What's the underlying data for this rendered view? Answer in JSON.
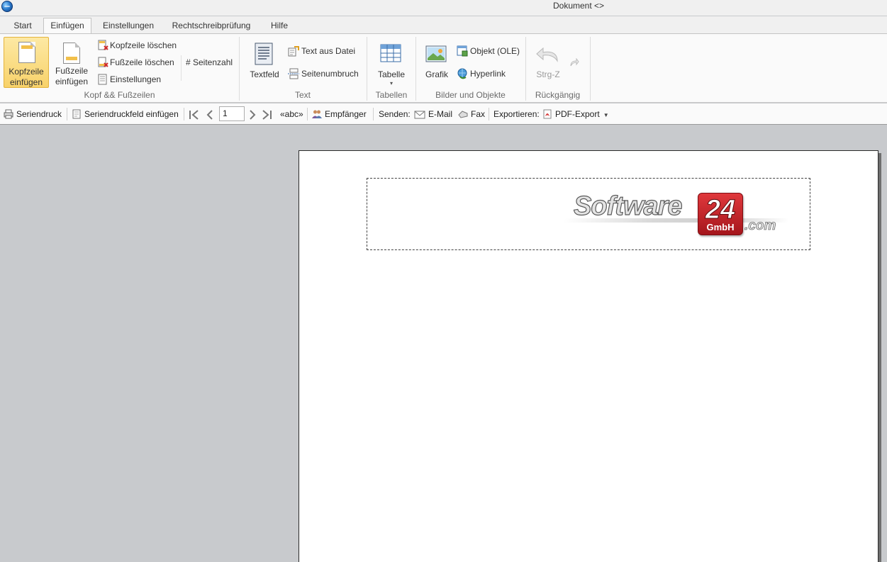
{
  "window": {
    "title": "Dokument <>"
  },
  "tabs": [
    {
      "label": "Start"
    },
    {
      "label": "Einfügen",
      "active": true
    },
    {
      "label": "Einstellungen"
    },
    {
      "label": "Rechtschreibprüfung"
    },
    {
      "label": "Hilfe"
    }
  ],
  "ribbon": {
    "kopf": {
      "group_label": "Kopf && Fußzeilen",
      "kopfzeile_einfuegen_l1": "Kopfzeile",
      "kopfzeile_einfuegen_l2": "einfügen",
      "fusszeile_einfuegen_l1": "Fußzeile",
      "fusszeile_einfuegen_l2": "einfügen",
      "kopfzeile_loeschen": "Kopfzeile löschen",
      "fusszeile_loeschen": "Fußzeile löschen",
      "einstellungen": "Einstellungen",
      "seitenzahl": "# Seitenzahl"
    },
    "text": {
      "group_label": "Text",
      "textfeld": "Textfeld",
      "text_aus_datei": "Text aus Datei",
      "seitenumbruch": "Seitenumbruch"
    },
    "tabellen": {
      "group_label": "Tabellen",
      "tabelle": "Tabelle"
    },
    "bilder": {
      "group_label": "Bilder und Objekte",
      "grafik": "Grafik",
      "objekt_ole": "Objekt (OLE)",
      "hyperlink": "Hyperlink"
    },
    "rueckgaengig": {
      "group_label": "Rückgängig",
      "strg_z": "Strg-Z"
    }
  },
  "toolbar": {
    "seriendruck": "Seriendruck",
    "seriendruckfeld": "Seriendruckfeld einfügen",
    "page_value": "1",
    "abc": "«abc»",
    "empfaenger": "Empfänger",
    "senden_label": "Senden:",
    "email": "E-Mail",
    "fax": "Fax",
    "exportieren_label": "Exportieren:",
    "pdf_export": "PDF-Export"
  },
  "logo": {
    "word": "Software",
    "number": "24",
    "gmbh": "GmbH",
    "com": ".com"
  }
}
